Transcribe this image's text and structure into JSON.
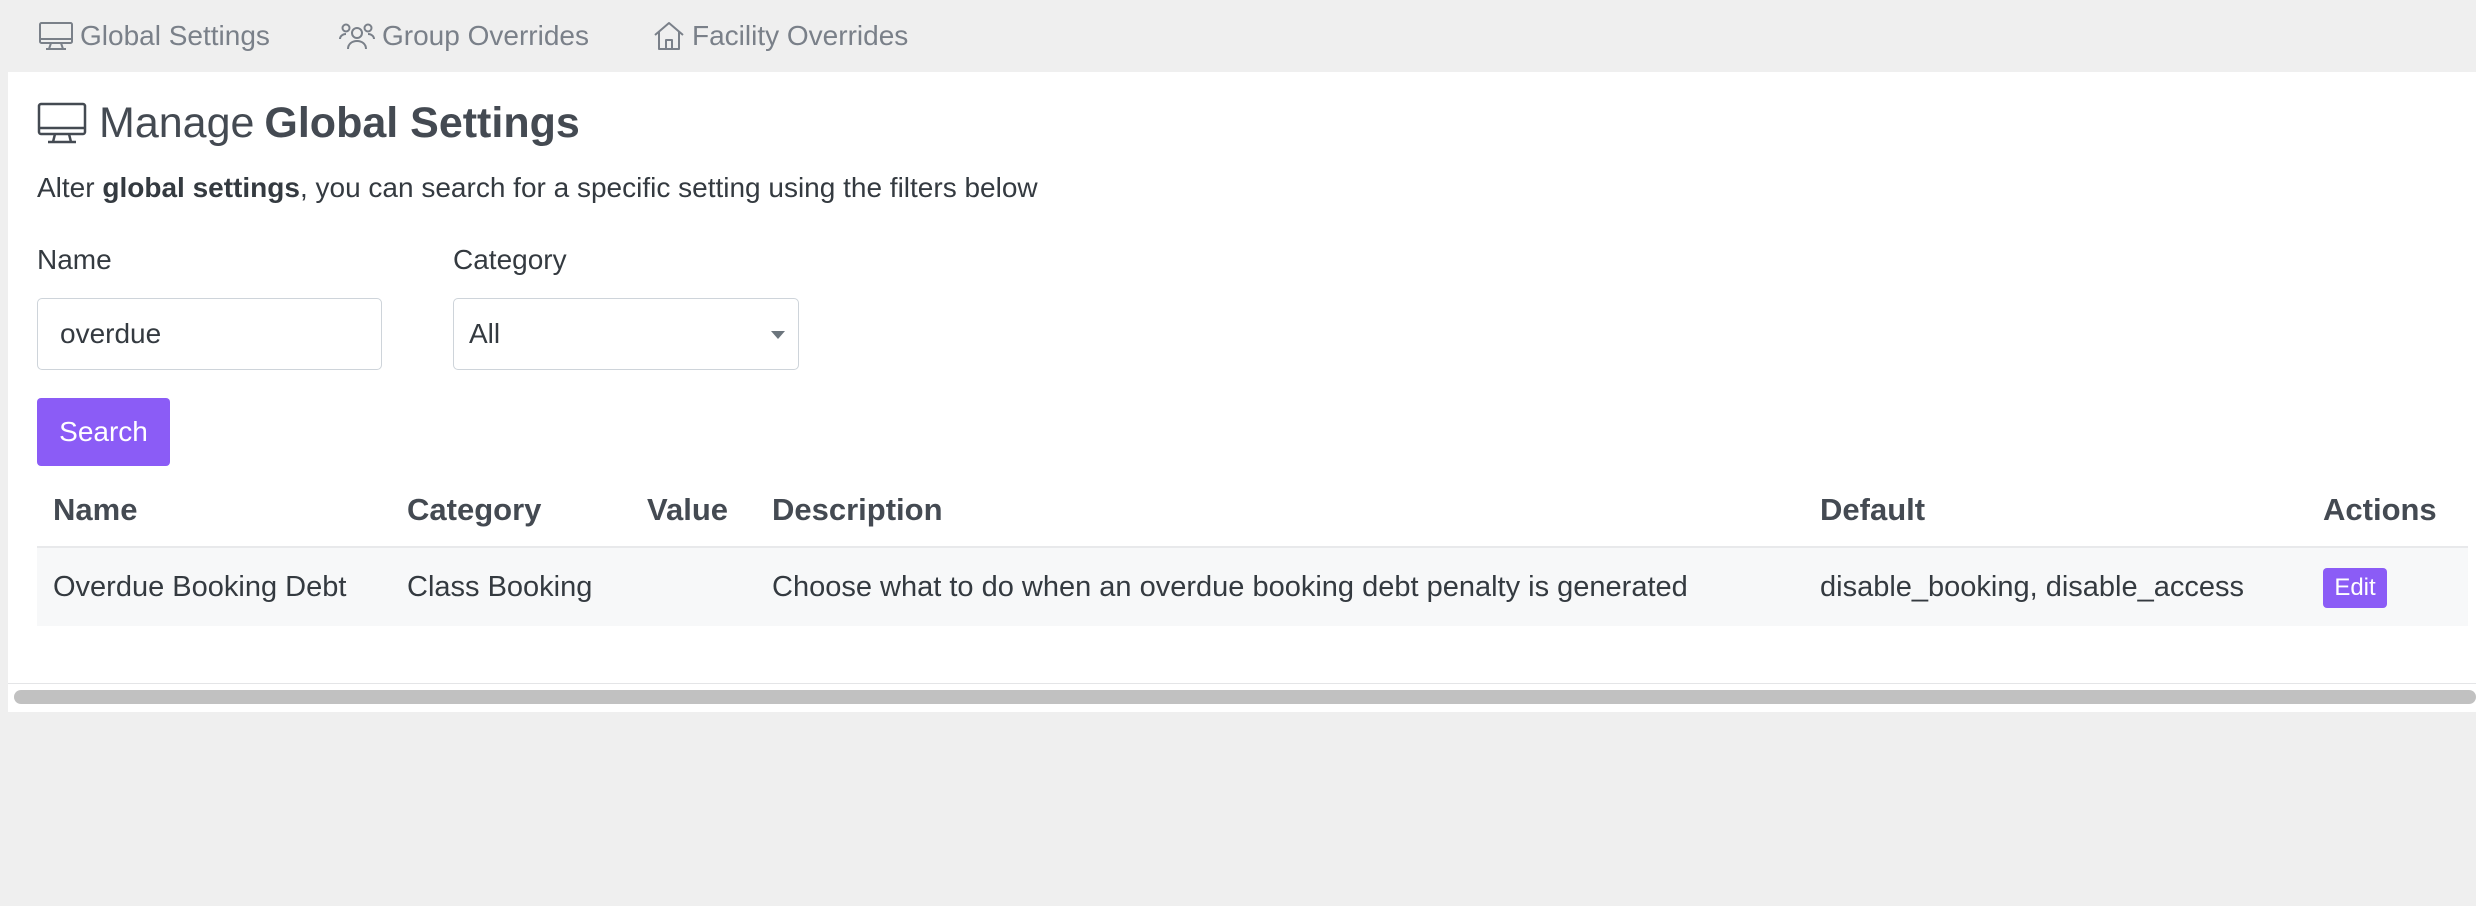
{
  "tabs": [
    {
      "label": "Global Settings",
      "icon": "monitor-icon"
    },
    {
      "label": "Group Overrides",
      "icon": "users-icon"
    },
    {
      "label": "Facility Overrides",
      "icon": "home-icon"
    }
  ],
  "header": {
    "title_prefix": "Manage",
    "title_strong": "Global Settings",
    "subtitle_pre": "Alter",
    "subtitle_bold": "global settings",
    "subtitle_post": ", you can search for a specific setting using the filters below"
  },
  "filters": {
    "name_label": "Name",
    "name_value": "overdue",
    "category_label": "Category",
    "category_value": "All",
    "search_label": "Search"
  },
  "table": {
    "headers": [
      "Name",
      "Category",
      "Value",
      "Description",
      "Default",
      "Actions"
    ],
    "rows": [
      {
        "name": "Overdue Booking Debt",
        "category": "Class Booking",
        "value": "",
        "description": "Choose what to do when an overdue booking debt penalty is generated",
        "default": "disable_booking, disable_access",
        "action": "Edit"
      }
    ]
  },
  "colors": {
    "accent": "#8b5cf6",
    "page_bg": "#efefef",
    "card_bg": "#ffffff",
    "row_bg": "#f7f8f9"
  }
}
